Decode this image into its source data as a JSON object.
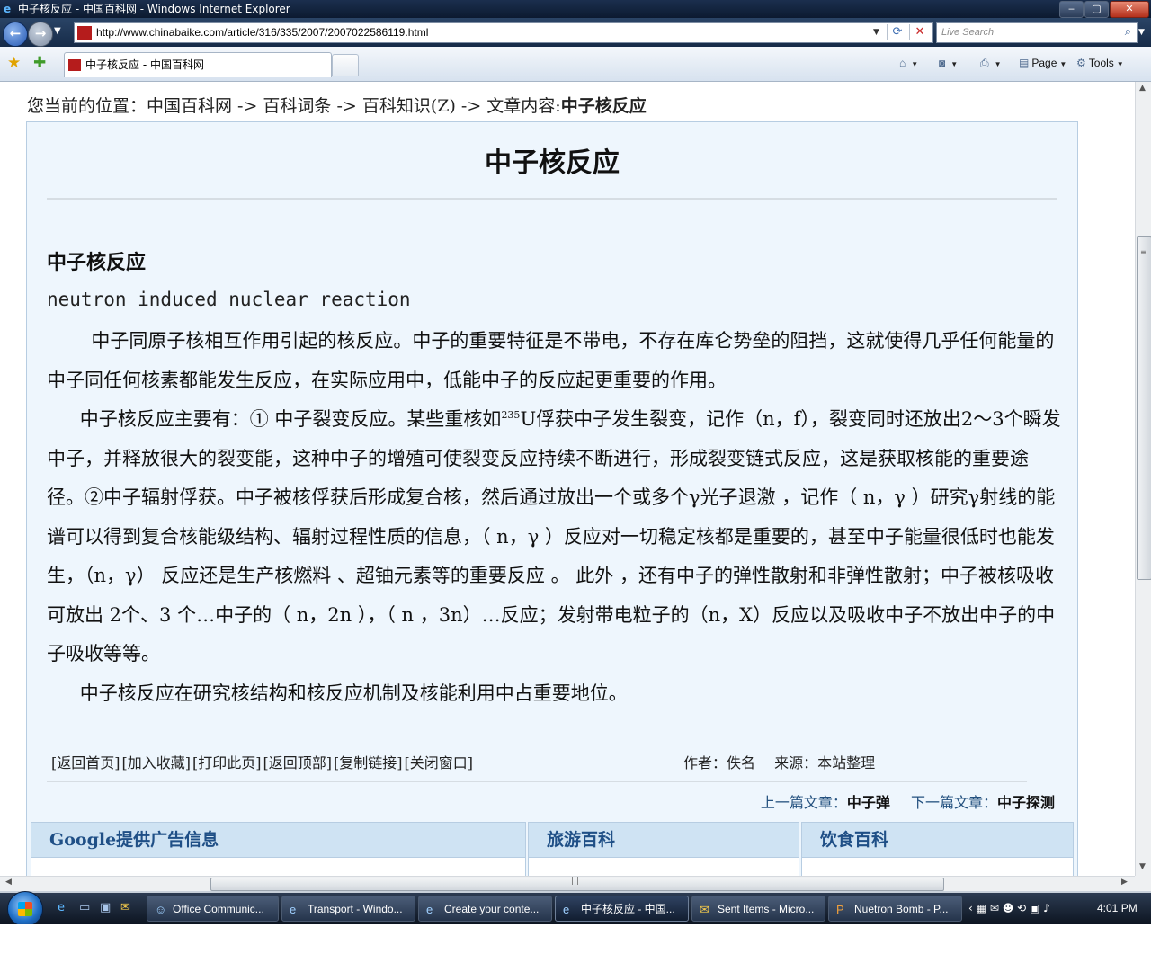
{
  "window": {
    "title": "中子核反应 - 中国百科网 - Windows Internet Explorer",
    "buttons": [
      "‒",
      "▢",
      "✕"
    ]
  },
  "navbar": {
    "url": "http://www.chinabaike.com/article/316/335/2007/2007022586119.html",
    "search_placeholder": "Live Search"
  },
  "tabs": [
    {
      "label": "中子核反应 - 中国百科网",
      "active": true
    }
  ],
  "commandbar": {
    "page_label": "Page",
    "tools_label": "Tools"
  },
  "content": {
    "breadcrumb_prefix": "您当前的位置：中国百科网 -> 百科词条 -> 百科知识(Z) -> 文章内容:",
    "breadcrumb_current": "中子核反应",
    "title": "中子核反应",
    "subheading": "中子核反应",
    "english": "neutron induced nuclear reaction",
    "para1": "中子同原子核相互作用引起的核反应。中子的重要特征是不带电，不存在库仑势垒的阻挡，这就使得几乎任何能量的中子同任何核素都能发生反应，在实际应用中，低能中子的反应起更重要的作用。",
    "para2_a": "中子核反应主要有：① 中子裂变反应。某些重核如",
    "para2_sup": "235",
    "para2_b": "U俘获中子发生裂变，记作（n，f），裂变同时还放出2～3个瞬发中子，并释放很大的裂变能，这种中子的增殖可使裂变反应持续不断进行，形成裂变链式反应，这是获取核能的重要途径。②中子辐射俘获。中子被核俘获后形成复合核，然后通过放出一个或多个γ光子退激 ，记作（ n，γ ）研究γ射线的能谱可以得到复合核能级结构、辐射过程性质的信息，（ n，γ ）反应对一切稳定核都是重要的，甚至中子能量很低时也能发生，（n，γ） 反应还是生产核燃料 、超铀元素等的重要反应 。 此外 ，还有中子的弹性散射和非弹性散射；中子被核吸收可放出 2个、3 个…中子的（ n，2n ），（ n ，3n）…反应；发射带电粒子的（n，X）反应以及吸收中子不放出中子的中子吸收等等。",
    "para3": "中子核反应在研究核结构和核反应机制及核能利用中占重要地位。",
    "links": [
      "[返回首页]",
      "[加入收藏]",
      "[打印此页]",
      "[返回顶部]",
      "[复制链接]",
      "[关闭窗口]"
    ],
    "author": "作者：佚名　 来源：本站整理",
    "prev_label": "上一篇文章：",
    "prev_title": "中子弹",
    "next_label": "下一篇文章：",
    "next_title": "中子探测",
    "boxes": [
      "Google提供广告信息",
      "旅游百科",
      "饮食百科"
    ]
  },
  "taskbar": {
    "items": [
      {
        "label": "Office Communic...",
        "active": false
      },
      {
        "label": "Transport - Windo...",
        "active": false
      },
      {
        "label": "Create your conte...",
        "active": false
      },
      {
        "label": "中子核反应 - 中国...",
        "active": true
      },
      {
        "label": "Sent Items - Micro...",
        "active": false
      },
      {
        "label": "Nuetron Bomb - P...",
        "active": false
      }
    ],
    "clock": "4:01 PM"
  }
}
